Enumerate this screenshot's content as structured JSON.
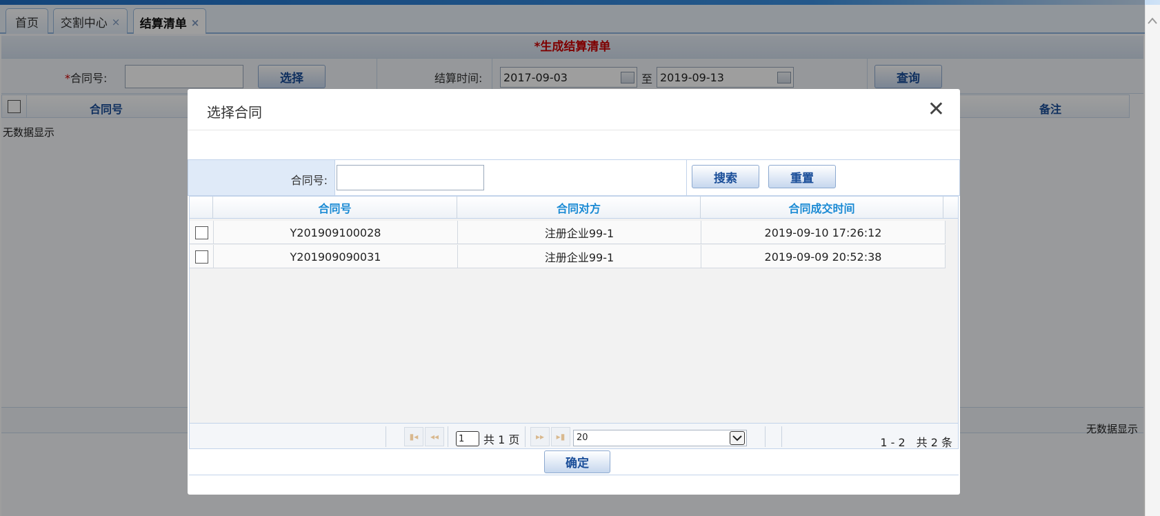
{
  "tabs": [
    {
      "label": "首页",
      "closable": false,
      "active": false
    },
    {
      "label": "交割中心",
      "closable": true,
      "active": false
    },
    {
      "label": "结算清单",
      "closable": true,
      "active": true
    }
  ],
  "tab_close_glyph": "×",
  "page": {
    "title": "*生成结算清单",
    "form": {
      "contract_required_mark": "*",
      "contract_label": "合同号:",
      "contract_value": "",
      "select_button": "选择",
      "settle_time_label": "结算时间:",
      "date_from": "2017-09-03",
      "date_to_sep": "至",
      "date_to": "2019-09-13",
      "query_button": "查询"
    },
    "grid": {
      "columns": [
        "合同号",
        "备注"
      ],
      "empty_text": "无数据显示"
    },
    "bottom_empty_text": "无数据显示"
  },
  "modal": {
    "title": "选择合同",
    "close_glyph": "✕",
    "search": {
      "label": "合同号:",
      "value": "",
      "search_button": "搜索",
      "reset_button": "重置"
    },
    "columns": [
      "合同号",
      "合同对方",
      "合同成交时间"
    ],
    "rows": [
      {
        "contract_no": "Y201909100028",
        "counterparty": "注册企业99-1",
        "deal_time": "2019-09-10 17:26:12"
      },
      {
        "contract_no": "Y201909090031",
        "counterparty": "注册企业99-1",
        "deal_time": "2019-09-09 20:52:38"
      }
    ],
    "pager": {
      "page_input": "1",
      "total_pages_text": "共 1 页",
      "page_size": "20",
      "summary": "1 - 2　共 2 条"
    },
    "confirm_button": "确定"
  },
  "colors": {
    "accent_blue": "#1a4e99",
    "header_blue": "#1a8ad4",
    "required_red": "#cc0000"
  },
  "icons": {
    "calendar": "calendar-icon",
    "close": "close-icon",
    "pager_first": "first-page-icon",
    "pager_prev": "prev-page-icon",
    "pager_next": "next-page-icon",
    "pager_last": "last-page-icon",
    "dropdown": "chevron-down-icon",
    "scroll_up": "chevron-up-icon"
  }
}
